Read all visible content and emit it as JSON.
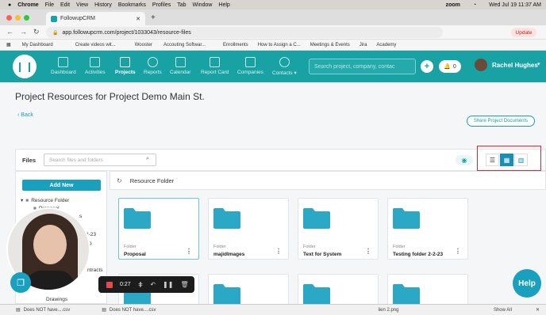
{
  "mac_menubar": {
    "apple": "",
    "items": [
      "Chrome",
      "File",
      "Edit",
      "View",
      "History",
      "Bookmarks",
      "Profiles",
      "Tab",
      "Window",
      "Help"
    ],
    "zoom": "zoom",
    "clock": "Wed Jul 19  11:37 AM"
  },
  "browser": {
    "tab_title": "FollowupCRM",
    "url": "app.followupcrm.com/project/1033043/resource-files",
    "update_label": "Update",
    "bookmarks": [
      "My Dashboard",
      "Create videos wit...",
      "Wooster",
      "Accouting Softwar...",
      "Enrollments",
      "How to Assign a C...",
      "Meetings & Events",
      "Jira",
      "Academy"
    ]
  },
  "nav": {
    "items": [
      "Dashboard",
      "Activities",
      "Projects",
      "Reports",
      "Calendar",
      "Report Card",
      "Companies",
      "Contacts"
    ],
    "active": "Projects",
    "search_placeholder": "Search project, company, contac",
    "notification_count": "0",
    "user_name": "Rachel Hughes"
  },
  "page": {
    "title": "Project Resources for Project Demo Main St.",
    "back_label": "Back",
    "share_button": "Share Project Documents"
  },
  "files_panel": {
    "label": "Files",
    "search_placeholder": "Search files and folders",
    "add_new_label": "Add New",
    "tree": [
      "Resource Folder",
      "Proposal",
      "s",
      "2-23",
      "9",
      "ntracts",
      "Drawings"
    ],
    "breadcrumb": "Resource Folder"
  },
  "folders": [
    {
      "type": "Folder",
      "name": "Proposal"
    },
    {
      "type": "Folder",
      "name": "majidImages"
    },
    {
      "type": "Folder",
      "name": "Text for System"
    },
    {
      "type": "Folder",
      "name": "Testing folder 2-2-23"
    }
  ],
  "recorder": {
    "time": "0:27"
  },
  "help_label": "Help",
  "taskbar": {
    "items": [
      "Does NOT have....csv",
      "Does NOT have....csv",
      "lien 2.png"
    ],
    "show_all": "Show All"
  },
  "colors": {
    "brand": "#18a2a4",
    "add_new": "#1aa0bf",
    "folder": "#2aa8c6",
    "highlight_box": "#e0292c"
  }
}
